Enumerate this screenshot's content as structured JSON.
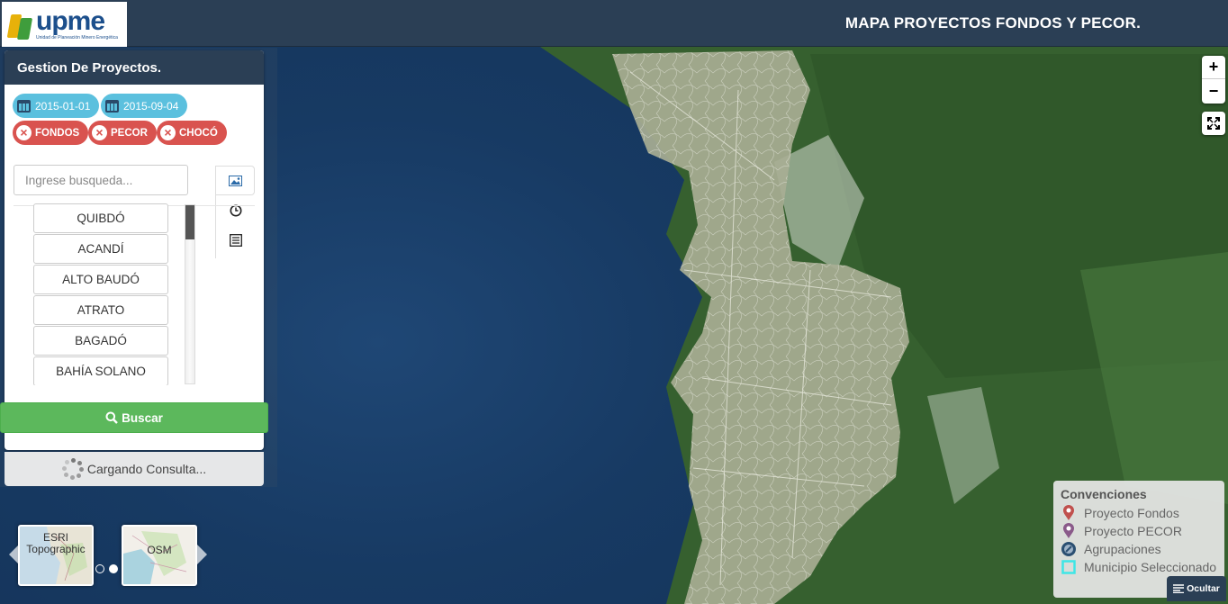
{
  "header": {
    "logo_text": "upme",
    "logo_subtitle": "Unidad de Planeación Minero Energética",
    "title": "MAPA PROYECTOS FONDOS Y PECOR."
  },
  "panel": {
    "title": "Gestion De Proyectos.",
    "dates": [
      "2015-01-01",
      "2015-09-04"
    ],
    "filters": [
      "FONDOS",
      "PECOR",
      "CHOCÓ"
    ],
    "search_placeholder": "Ingrese busqueda...",
    "municipios": [
      "QUIBDÓ",
      "ACANDÍ",
      "ALTO BAUDÓ",
      "ATRATO",
      "BAGADÓ",
      "BAHÍA SOLANO"
    ],
    "buscar_label": "Buscar",
    "loading_label": "Cargando Consulta...",
    "tab_icons": [
      "image-icon",
      "clock-icon",
      "list-icon"
    ]
  },
  "map_controls": {
    "zoom_in": "+",
    "zoom_out": "−"
  },
  "legend": {
    "title": "Convenciones",
    "items": [
      {
        "label": "Proyecto Fondos",
        "icon": "marker-red-icon",
        "color": "#c0504d"
      },
      {
        "label": "Proyecto PECOR",
        "icon": "marker-purple-icon",
        "color": "#8a5a8a"
      },
      {
        "label": "Agrupaciones",
        "icon": "cluster-icon",
        "color": "#2b4f72"
      },
      {
        "label": "Municipio Seleccionado",
        "icon": "square-cyan-icon",
        "color": "#3ee6e6"
      }
    ]
  },
  "ocultar_label": "Ocultar",
  "basemaps": [
    {
      "label": "ESRI Topographic"
    },
    {
      "label": "OSM"
    }
  ],
  "colors": {
    "header": "#2b3f55",
    "date_chip": "#5bc0de",
    "filter_chip": "#d9534f",
    "buscar": "#5cb85c"
  }
}
